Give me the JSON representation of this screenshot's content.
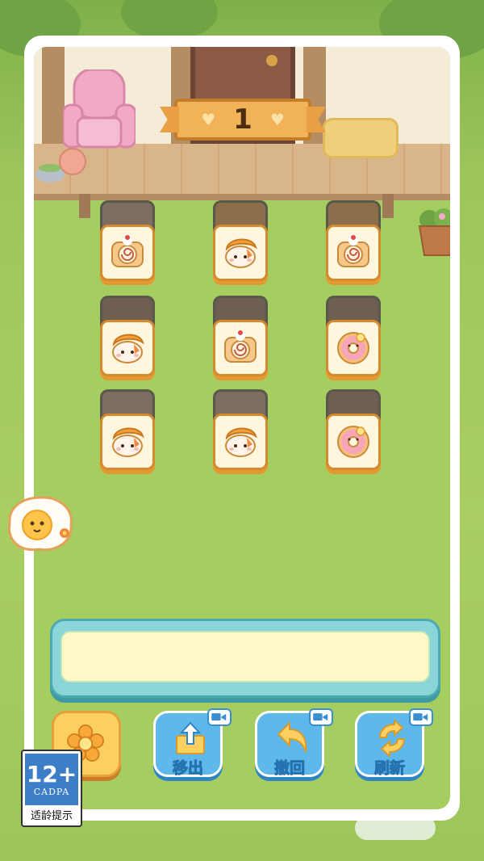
{
  "level": {
    "number": "1"
  },
  "tiles": [
    {
      "icon": "swiss-roll-icon",
      "under": "cat-bun"
    },
    {
      "icon": "cat-bread-icon",
      "under": "bread"
    },
    {
      "icon": "swiss-roll-icon",
      "under": "bread"
    },
    {
      "icon": "cat-bread-icon",
      "under": "donut"
    },
    {
      "icon": "swiss-roll-icon",
      "under": "donut"
    },
    {
      "icon": "donut-icon",
      "under": "donut"
    },
    {
      "icon": "cat-bread-icon",
      "under": "cat-bun"
    },
    {
      "icon": "cat-bread-icon",
      "under": "cat-bun"
    },
    {
      "icon": "donut-icon",
      "under": "donut"
    }
  ],
  "tray": {
    "slots_filled": 0
  },
  "toolbar": {
    "move_out_label": "移出",
    "undo_label": "撤回",
    "refresh_label": "刷新"
  },
  "badge": {
    "age": "12+",
    "org": "CADPA",
    "caption": "适龄提示"
  },
  "colors": {
    "tile_face": "#fff6de",
    "tile_border": "#d58a2c",
    "button_blue": "#5fb8ea",
    "tray_teal": "#8ad5d8",
    "banner_orange": "#f2b257"
  }
}
